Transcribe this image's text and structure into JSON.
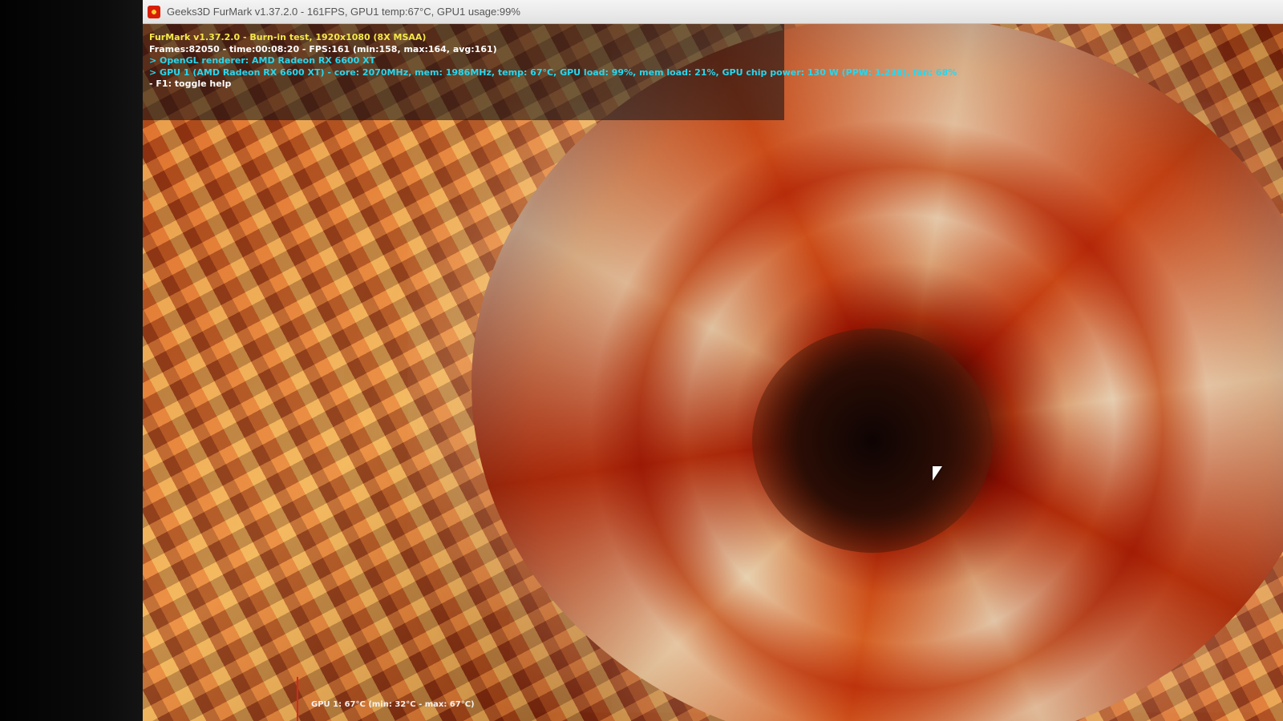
{
  "window": {
    "title": "Geeks3D FurMark v1.37.2.0 - 161FPS, GPU1 temp:67°C, GPU1 usage:99%",
    "icon": "furmark-app-icon"
  },
  "osd": {
    "line1": "FurMark v1.37.2.0 - Burn-in test, 1920x1080 (8X MSAA)",
    "line2": "Frames:82050 - time:00:08:20 - FPS:161 (min:158, max:164, avg:161)",
    "line3": "> OpenGL renderer: AMD Radeon RX 6600 XT",
    "line4": "> GPU 1 (AMD Radeon RX 6600 XT) - core: 2070MHz, mem: 1986MHz, temp: 67°C, GPU load: 99%, mem load: 21%, GPU chip power: 130 W (PPW: 1.238), fan: 68%",
    "line5": "- F1: toggle help",
    "colors": {
      "title_line": "#f6e84a",
      "stats_line": "#ffffff",
      "renderer_line": "#26d8f0"
    }
  },
  "temp_graph": {
    "label": "GPU 1: 67°C (min: 32°C - max: 67°C)"
  }
}
